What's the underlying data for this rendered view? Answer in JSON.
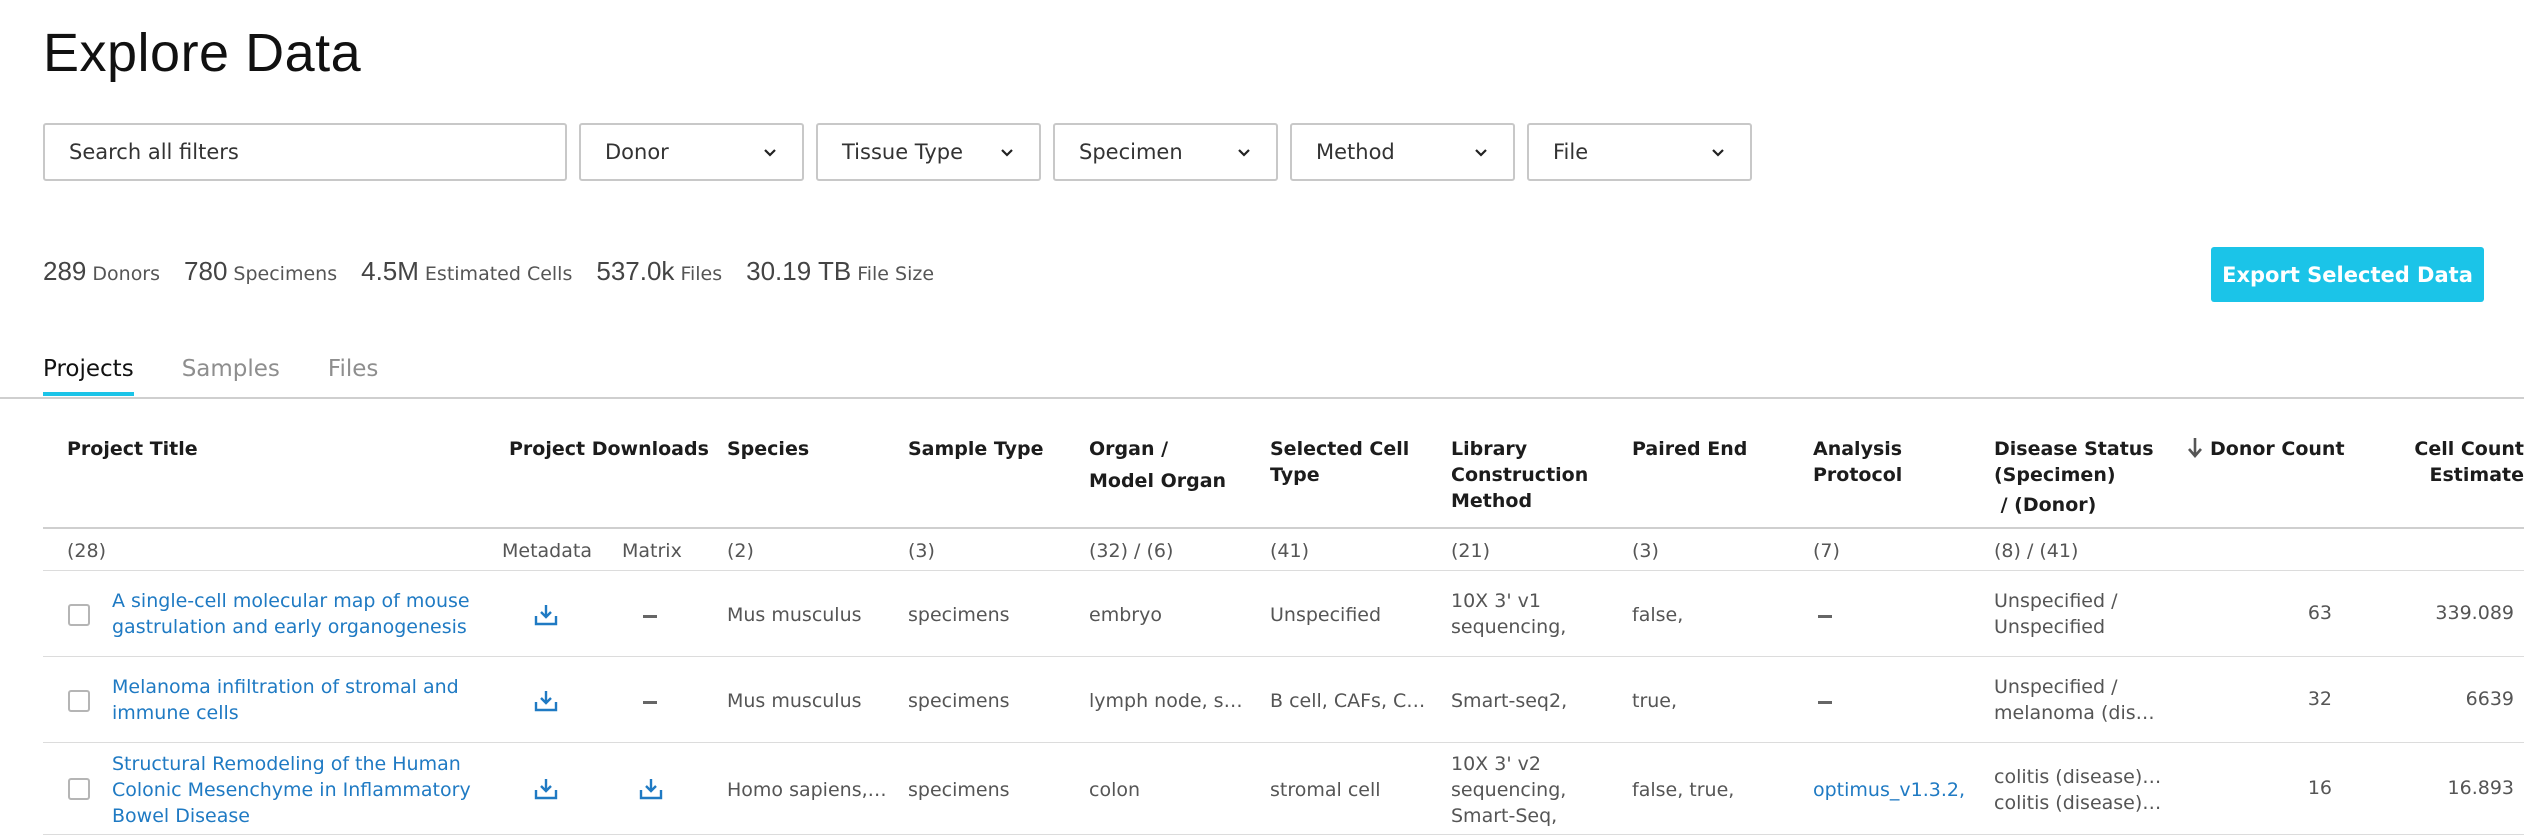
{
  "page": {
    "title": "Explore Data"
  },
  "search": {
    "placeholder": "Search all filters"
  },
  "filters": [
    "Donor",
    "Tissue Type",
    "Specimen",
    "Method",
    "File"
  ],
  "stats": [
    {
      "value": "289",
      "label": "Donors"
    },
    {
      "value": "780",
      "label": "Specimens"
    },
    {
      "value": "4.5M",
      "label": "Estimated Cells"
    },
    {
      "value": "537.0k",
      "label": "Files"
    },
    {
      "value": "30.19 TB",
      "label": "File Size"
    }
  ],
  "export_label": "Export Selected Data",
  "tabs": [
    "Projects",
    "Samples",
    "Files"
  ],
  "active_tab": "Projects",
  "table": {
    "headers": {
      "project_title": "Project Title",
      "downloads": "Project Downloads",
      "species": "Species",
      "sample_type": "Sample Type",
      "organ_line1": "Organ /",
      "organ_line2": "Model Organ",
      "cell_type_line1": "Selected Cell",
      "cell_type_line2": "Type",
      "library_line1": "Library",
      "library_line2": "Construction",
      "library_line3": "Method",
      "paired_end": "Paired End",
      "analysis_line1": "Analysis",
      "analysis_line2": "Protocol",
      "disease_line1": "Disease Status",
      "disease_line2": "(Specimen)",
      "disease_line3": " / (Donor)",
      "donor_count": "Donor Count",
      "cell_count_line1": "Cell Count",
      "cell_count_line2": "Estimate"
    },
    "counts": {
      "project_title": "(28)",
      "metadata": "Metadata",
      "matrix": "Matrix",
      "species": "(2)",
      "sample_type": "(3)",
      "organ": "(32) / (6)",
      "cell_type": "(41)",
      "library": "(21)",
      "paired_end": "(3)",
      "analysis": "(7)",
      "disease": "(8) / (41)"
    },
    "rows": [
      {
        "title_line1": "A single-cell molecular map of mouse",
        "title_line2": "gastrulation and early organogenesis",
        "title_line3": "",
        "matrix_available": false,
        "species": "Mus musculus",
        "sample_type": "specimens",
        "organ": "embryo",
        "cell_type": "Unspecified",
        "library_line1": "10X 3' v1",
        "library_line2": "sequencing,",
        "library_line3": "",
        "paired_end": "false,",
        "analysis": "",
        "disease_line1": "Unspecified /",
        "disease_line2": "Unspecified",
        "donor_count": "63",
        "cell_count": "339.089"
      },
      {
        "title_line1": "Melanoma infiltration of stromal and",
        "title_line2": "immune cells",
        "title_line3": "",
        "matrix_available": false,
        "species": "Mus musculus",
        "sample_type": "specimens",
        "organ": "lymph node, s…",
        "cell_type": "B cell, CAFs, C…",
        "library_line1": "Smart-seq2,",
        "library_line2": "",
        "library_line3": "",
        "paired_end": "true,",
        "analysis": "",
        "disease_line1": "Unspecified /",
        "disease_line2": "melanoma (dis…",
        "donor_count": "32",
        "cell_count": "6639"
      },
      {
        "title_line1": "Structural Remodeling of the Human",
        "title_line2": "Colonic Mesenchyme in Inflammatory",
        "title_line3": "Bowel Disease",
        "matrix_available": true,
        "species": "Homo sapiens,…",
        "sample_type": "specimens",
        "organ": "colon",
        "cell_type": "stromal cell",
        "library_line1": "10X 3' v2",
        "library_line2": "sequencing,",
        "library_line3": "Smart-Seq,",
        "paired_end": "false, true,",
        "analysis": "optimus_v1.3.2,",
        "disease_line1": "colitis (disease)…",
        "disease_line2": "colitis (disease)…",
        "donor_count": "16",
        "cell_count": "16.893"
      }
    ]
  },
  "colors": {
    "accent": "#1bc4e8",
    "link": "#1f7ac3",
    "border": "#c8c8c8"
  }
}
